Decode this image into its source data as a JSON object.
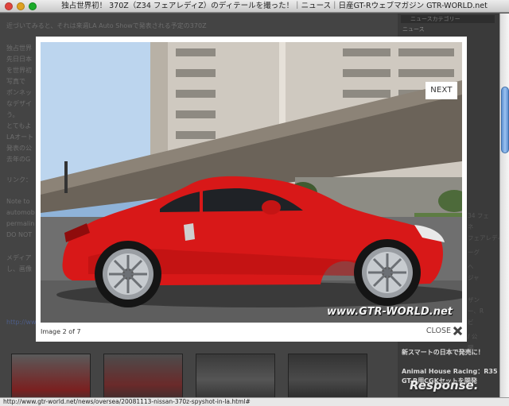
{
  "window": {
    "title": "独占世界初！ 370Z（Z34 フェアレディZ）のディテールを撮った！｜ニュース｜日産GT-Rウェブマガジン GTR-WORLD.net"
  },
  "background_page": {
    "lines": [
      "近づいてみると、それは来週LA Auto Showで発表される予定の370Z",
      "独占世界",
      "先日日本",
      "を世界初",
      "写真で",
      "ポンネッ",
      "なデザイ",
      "う。",
      "とてもよ",
      "LAオート",
      "発表の公",
      "去年のG",
      "リンク：",
      "Note to",
      "automob",
      "permalin",
      "DO NOT",
      "メディア",
      "し、画像"
    ],
    "link_text": "http://www",
    "sidebar": {
      "header": "ニュースカテゴリー",
      "section": "ニュース",
      "items": [
        "34 フェ",
        "ネ",
        "フェアレディ",
        "ーグ",
        "へ",
        "ジャ",
        "ザン",
        "ー、R",
        "ビ",
        "/ 公",
        "開",
        "新",
        "ガ",
        "登場",
        "更新"
      ],
      "bright_items": [
        "新スマートの日本で発売に！",
        "Animal House Racing：R35",
        "GT-R用CGKセットを開発"
      ]
    }
  },
  "lightbox": {
    "next_label": "NEXT",
    "counter_text": "Image 2 of 7",
    "close_label": "CLOSE",
    "watermark": "www.GTR-WORLD.net",
    "photo_subject": "red Nissan 370Z side view under overpass"
  },
  "status_bar": {
    "url": "http://www.gtr-world.net/news/oversea/20081113-nissan-370z-spyshot-in-la.html#"
  },
  "overlay_logo": "Response.",
  "colors": {
    "car_red": "#d81818",
    "scroll_thumb": "#7aa8e4",
    "dim_bg": "#444444"
  }
}
